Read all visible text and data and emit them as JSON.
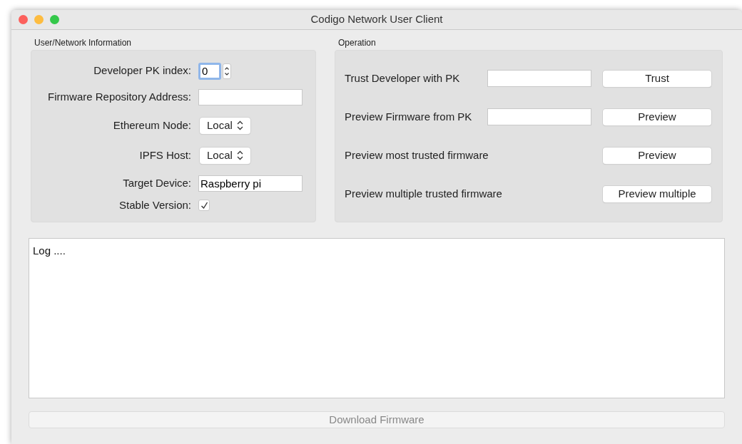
{
  "window": {
    "title": "Codigo Network User Client"
  },
  "user_network": {
    "title": "User/Network Information",
    "fields": [
      {
        "kind": "spinner",
        "label": "Developer PK index:",
        "value": "0",
        "focused": true
      },
      {
        "kind": "text",
        "label": "Firmware Repository Address:"
      },
      {
        "kind": "select",
        "label": "Ethereum Node:",
        "value": "Local"
      },
      {
        "kind": "select",
        "label": "IPFS Host:",
        "value": "Local"
      },
      {
        "kind": "text",
        "label": "Target Device:",
        "value": "Raspberry pi"
      },
      {
        "kind": "checkbox",
        "label": "Stable Version:",
        "checked": true
      }
    ]
  },
  "operation": {
    "title": "Operation",
    "rows": [
      {
        "label": "Trust Developer with PK",
        "has_field": true,
        "button": "Trust"
      },
      {
        "label": "Preview Firmware from PK",
        "has_field": true,
        "button": "Preview"
      },
      {
        "label": "Preview most trusted firmware",
        "has_field": false,
        "button": "Preview"
      },
      {
        "label": "Preview multiple trusted firmware",
        "has_field": false,
        "button": "Preview multiple"
      }
    ]
  },
  "log": {
    "value": "Log ...."
  },
  "download_button": {
    "label": "Download Firmware",
    "disabled": true
  }
}
